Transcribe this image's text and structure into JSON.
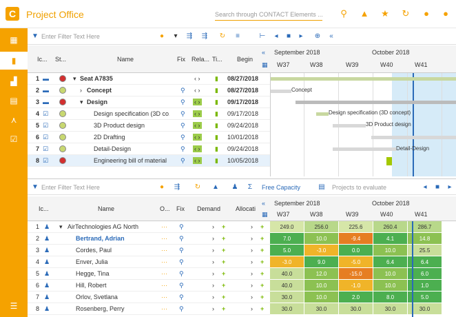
{
  "header": {
    "logo": "C",
    "title": "Project Office",
    "search_placeholder": "Search through CONTACT Elements ..."
  },
  "top_filter": {
    "placeholder": "Enter Filter Text Here"
  },
  "bottom_filter": {
    "placeholder": "Enter Filter Text Here",
    "capacity_label": "Free Capacity",
    "projects_placeholder": "Projects to evaluate"
  },
  "top_grid": {
    "headers": {
      "ic": "Ic...",
      "st": "St...",
      "name": "Name",
      "fix": "Fix",
      "rela": "Rela...",
      "ti": "Ti...",
      "begin": "Begin"
    },
    "months": [
      "September 2018",
      "October 2018"
    ],
    "weeks": [
      "W37",
      "W38",
      "W39",
      "W40",
      "W41"
    ],
    "rows": [
      {
        "num": "1",
        "name": "Seat A7835",
        "begin": "08/27/2018"
      },
      {
        "num": "2",
        "name": "Concept",
        "begin": "08/27/2018"
      },
      {
        "num": "3",
        "name": "Design",
        "begin": "09/17/2018"
      },
      {
        "num": "4",
        "name": "Design specification (3D co...",
        "begin": "09/17/2018"
      },
      {
        "num": "5",
        "name": "3D Product design",
        "begin": "09/24/2018"
      },
      {
        "num": "6",
        "name": "2D Drafting",
        "begin": "10/01/2018"
      },
      {
        "num": "7",
        "name": "Detail-Design",
        "begin": "09/24/2018"
      },
      {
        "num": "8",
        "name": "Engineering bill of material",
        "begin": "10/05/2018"
      }
    ],
    "gantt_labels": [
      "Concept",
      "Design specification (3D concept)",
      "3D Product design",
      "Detail-Design"
    ]
  },
  "bottom_grid": {
    "headers": {
      "ic": "Ic...",
      "name": "Name",
      "o": "O...",
      "fix": "Fix",
      "demand": "Demand",
      "alloc": "Allocati"
    },
    "months": [
      "September 2018",
      "October 2018"
    ],
    "weeks": [
      "W37",
      "W38",
      "W39",
      "W40",
      "W41"
    ],
    "rows": [
      {
        "num": "1",
        "name": "AirTechnologies AG North",
        "values": [
          "249.0",
          "256.0",
          "225.6",
          "260.4",
          "286.7"
        ]
      },
      {
        "num": "2",
        "name": "Bertrand, Adrian",
        "values": [
          "7.0",
          "10.0",
          "-9.4",
          "4.1",
          "14.8"
        ]
      },
      {
        "num": "3",
        "name": "Cordes, Paul",
        "values": [
          "5.0",
          "-3.0",
          "0.0",
          "10.0",
          "25.5"
        ]
      },
      {
        "num": "4",
        "name": "Enver, Julia",
        "values": [
          "-3.0",
          "9.0",
          "-5.0",
          "6.4",
          "6.4"
        ]
      },
      {
        "num": "5",
        "name": "Hegge, Tina",
        "values": [
          "40.0",
          "12.0",
          "-15.0",
          "10.0",
          "6.0"
        ]
      },
      {
        "num": "6",
        "name": "Hill, Robert",
        "values": [
          "40.0",
          "10.0",
          "-1.0",
          "10.0",
          "1.0"
        ]
      },
      {
        "num": "7",
        "name": "Orlov, Svetlana",
        "values": [
          "30.0",
          "10.0",
          "2.0",
          "8.0",
          "5.0"
        ]
      },
      {
        "num": "8",
        "name": "Rosenberg, Perry",
        "values": [
          "30.0",
          "30.0",
          "30.0",
          "30.0",
          "30.0"
        ]
      }
    ]
  },
  "colors": {
    "accent": "#f5a200",
    "red": "#d32f2f",
    "green": "#7ab800",
    "blue": "#2a6ab8"
  }
}
